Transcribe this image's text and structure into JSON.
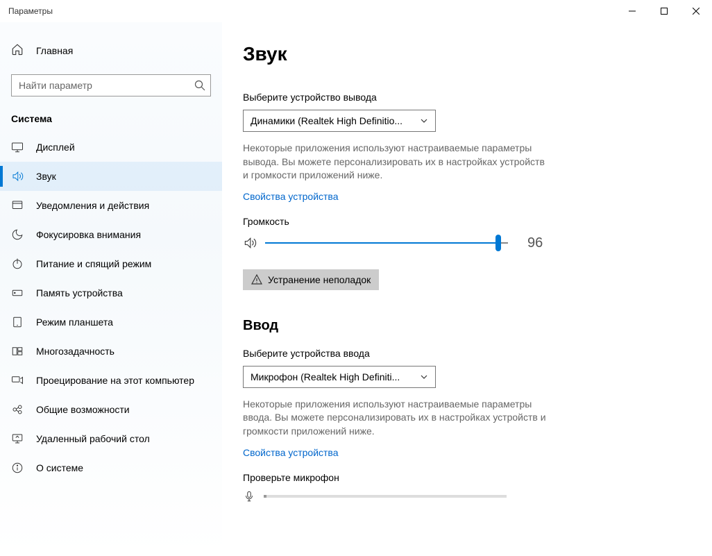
{
  "window": {
    "title": "Параметры"
  },
  "sidebar": {
    "home_label": "Главная",
    "search_placeholder": "Найти параметр",
    "category": "Система",
    "items": [
      {
        "label": "Дисплей",
        "icon": "display"
      },
      {
        "label": "Звук",
        "icon": "sound",
        "active": true
      },
      {
        "label": "Уведомления и действия",
        "icon": "notifications"
      },
      {
        "label": "Фокусировка внимания",
        "icon": "focus"
      },
      {
        "label": "Питание и спящий режим",
        "icon": "power"
      },
      {
        "label": "Память устройства",
        "icon": "storage"
      },
      {
        "label": "Режим планшета",
        "icon": "tablet"
      },
      {
        "label": "Многозадачность",
        "icon": "multitask"
      },
      {
        "label": "Проецирование на этот компьютер",
        "icon": "project"
      },
      {
        "label": "Общие возможности",
        "icon": "shared"
      },
      {
        "label": "Удаленный рабочий стол",
        "icon": "remote"
      },
      {
        "label": "О системе",
        "icon": "about"
      }
    ]
  },
  "main": {
    "title": "Звук",
    "output": {
      "select_label": "Выберите устройство вывода",
      "device": "Динамики (Realtek High Definitio...",
      "help": "Некоторые приложения используют настраиваемые параметры вывода. Вы можете персонализировать их в настройках устройств и громкости приложений ниже.",
      "properties_link": "Свойства устройства",
      "volume_label": "Громкость",
      "volume_value": "96",
      "volume_percent": 96,
      "troubleshoot": "Устранение неполадок"
    },
    "input": {
      "heading": "Ввод",
      "select_label": "Выберите устройства ввода",
      "device": "Микрофон (Realtek High Definiti...",
      "help": "Некоторые приложения используют настраиваемые параметры ввода. Вы можете персонализировать их в настройках устройств и громкости приложений ниже.",
      "properties_link": "Свойства устройства",
      "test_label": "Проверьте микрофон"
    }
  }
}
